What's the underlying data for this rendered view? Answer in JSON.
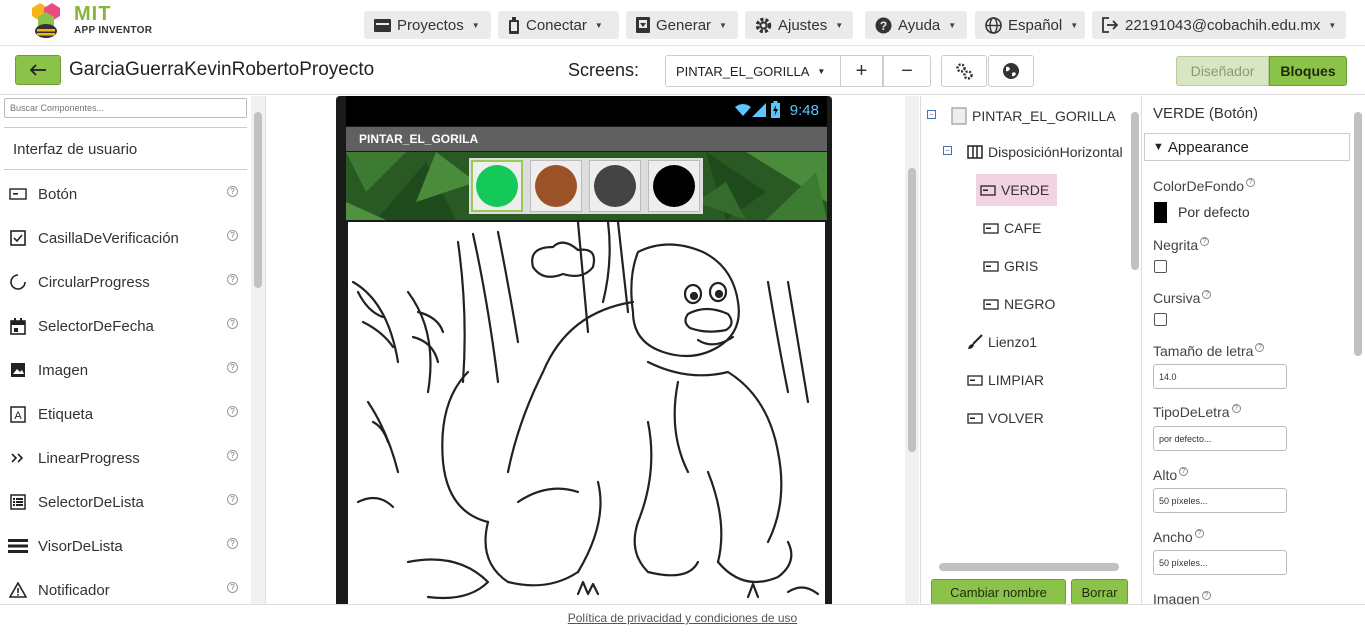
{
  "header": {
    "logo_title": "MIT",
    "logo_subtitle": "APP INVENTOR",
    "menus": [
      {
        "label": "Proyectos",
        "icon": "folder-icon"
      },
      {
        "label": "Conectar",
        "icon": "phone-icon"
      },
      {
        "label": "Generar",
        "icon": "package-icon"
      },
      {
        "label": "Ajustes",
        "icon": "gear-icon"
      },
      {
        "label": "Ayuda",
        "icon": "help-icon"
      },
      {
        "label": "Español",
        "icon": "globe-icon"
      }
    ],
    "account": "22191043@cobachih.edu.mx"
  },
  "toolbar": {
    "project_name": "GarciaGuerraKevinRobertoProyecto",
    "screens_label": "Screens:",
    "current_screen": "PINTAR_EL_GORILLA",
    "add_screen": "+",
    "remove_screen": "−",
    "designer_label": "Diseñador",
    "blocks_label": "Bloques"
  },
  "palette": {
    "search_placeholder": "Buscar Componentes...",
    "category": "Interfaz de usuario",
    "items": [
      {
        "label": "Botón",
        "icon": "button-icon"
      },
      {
        "label": "CasillaDeVerificación",
        "icon": "checkbox-icon"
      },
      {
        "label": "CircularProgress",
        "icon": "circular-progress-icon"
      },
      {
        "label": "SelectorDeFecha",
        "icon": "calendar-icon"
      },
      {
        "label": "Imagen",
        "icon": "image-icon"
      },
      {
        "label": "Etiqueta",
        "icon": "label-icon"
      },
      {
        "label": "LinearProgress",
        "icon": "linear-progress-icon"
      },
      {
        "label": "SelectorDeLista",
        "icon": "list-picker-icon"
      },
      {
        "label": "VisorDeLista",
        "icon": "list-view-icon"
      },
      {
        "label": "Notificador",
        "icon": "warning-icon"
      }
    ],
    "help_glyph": "?"
  },
  "viewer": {
    "status_time": "9:48",
    "app_title": "PINTAR_EL_GORILA",
    "color_buttons": [
      {
        "name": "VERDE",
        "color": "#14c95a"
      },
      {
        "name": "CAFE",
        "color": "#9b5226"
      },
      {
        "name": "GRIS",
        "color": "#444444"
      },
      {
        "name": "NEGRO",
        "color": "#000000"
      }
    ]
  },
  "tree": {
    "root": "PINTAR_EL_GORILLA",
    "arrangement": "DisposiciónHorizontal",
    "children": [
      "VERDE",
      "CAFE",
      "GRIS",
      "NEGRO"
    ],
    "canvas": "Lienzo1",
    "others": [
      "LIMPIAR",
      "VOLVER"
    ],
    "rename_button": "Cambiar nombre",
    "delete_button": "Borrar"
  },
  "properties": {
    "title": "VERDE (Botón)",
    "section": "Appearance",
    "background_color_label": "ColorDeFondo",
    "background_color_value": "Por defecto",
    "bold_label": "Negrita",
    "italic_label": "Cursiva",
    "font_size_label": "Tamaño de letra",
    "font_size_value": "14.0",
    "font_type_label": "TipoDeLetra",
    "font_type_value": "por defecto...",
    "height_label": "Alto",
    "height_value": "50 píxeles...",
    "width_label": "Ancho",
    "width_value": "50 píxeles...",
    "image_label": "Imagen",
    "help_glyph": "?"
  },
  "footer": {
    "link": "Política de privacidad y condiciones de uso"
  },
  "colors": {
    "accent_green": "#8bc34a",
    "selection_pink": "#f2d3e4",
    "status_blue": "#5ec6ff"
  }
}
